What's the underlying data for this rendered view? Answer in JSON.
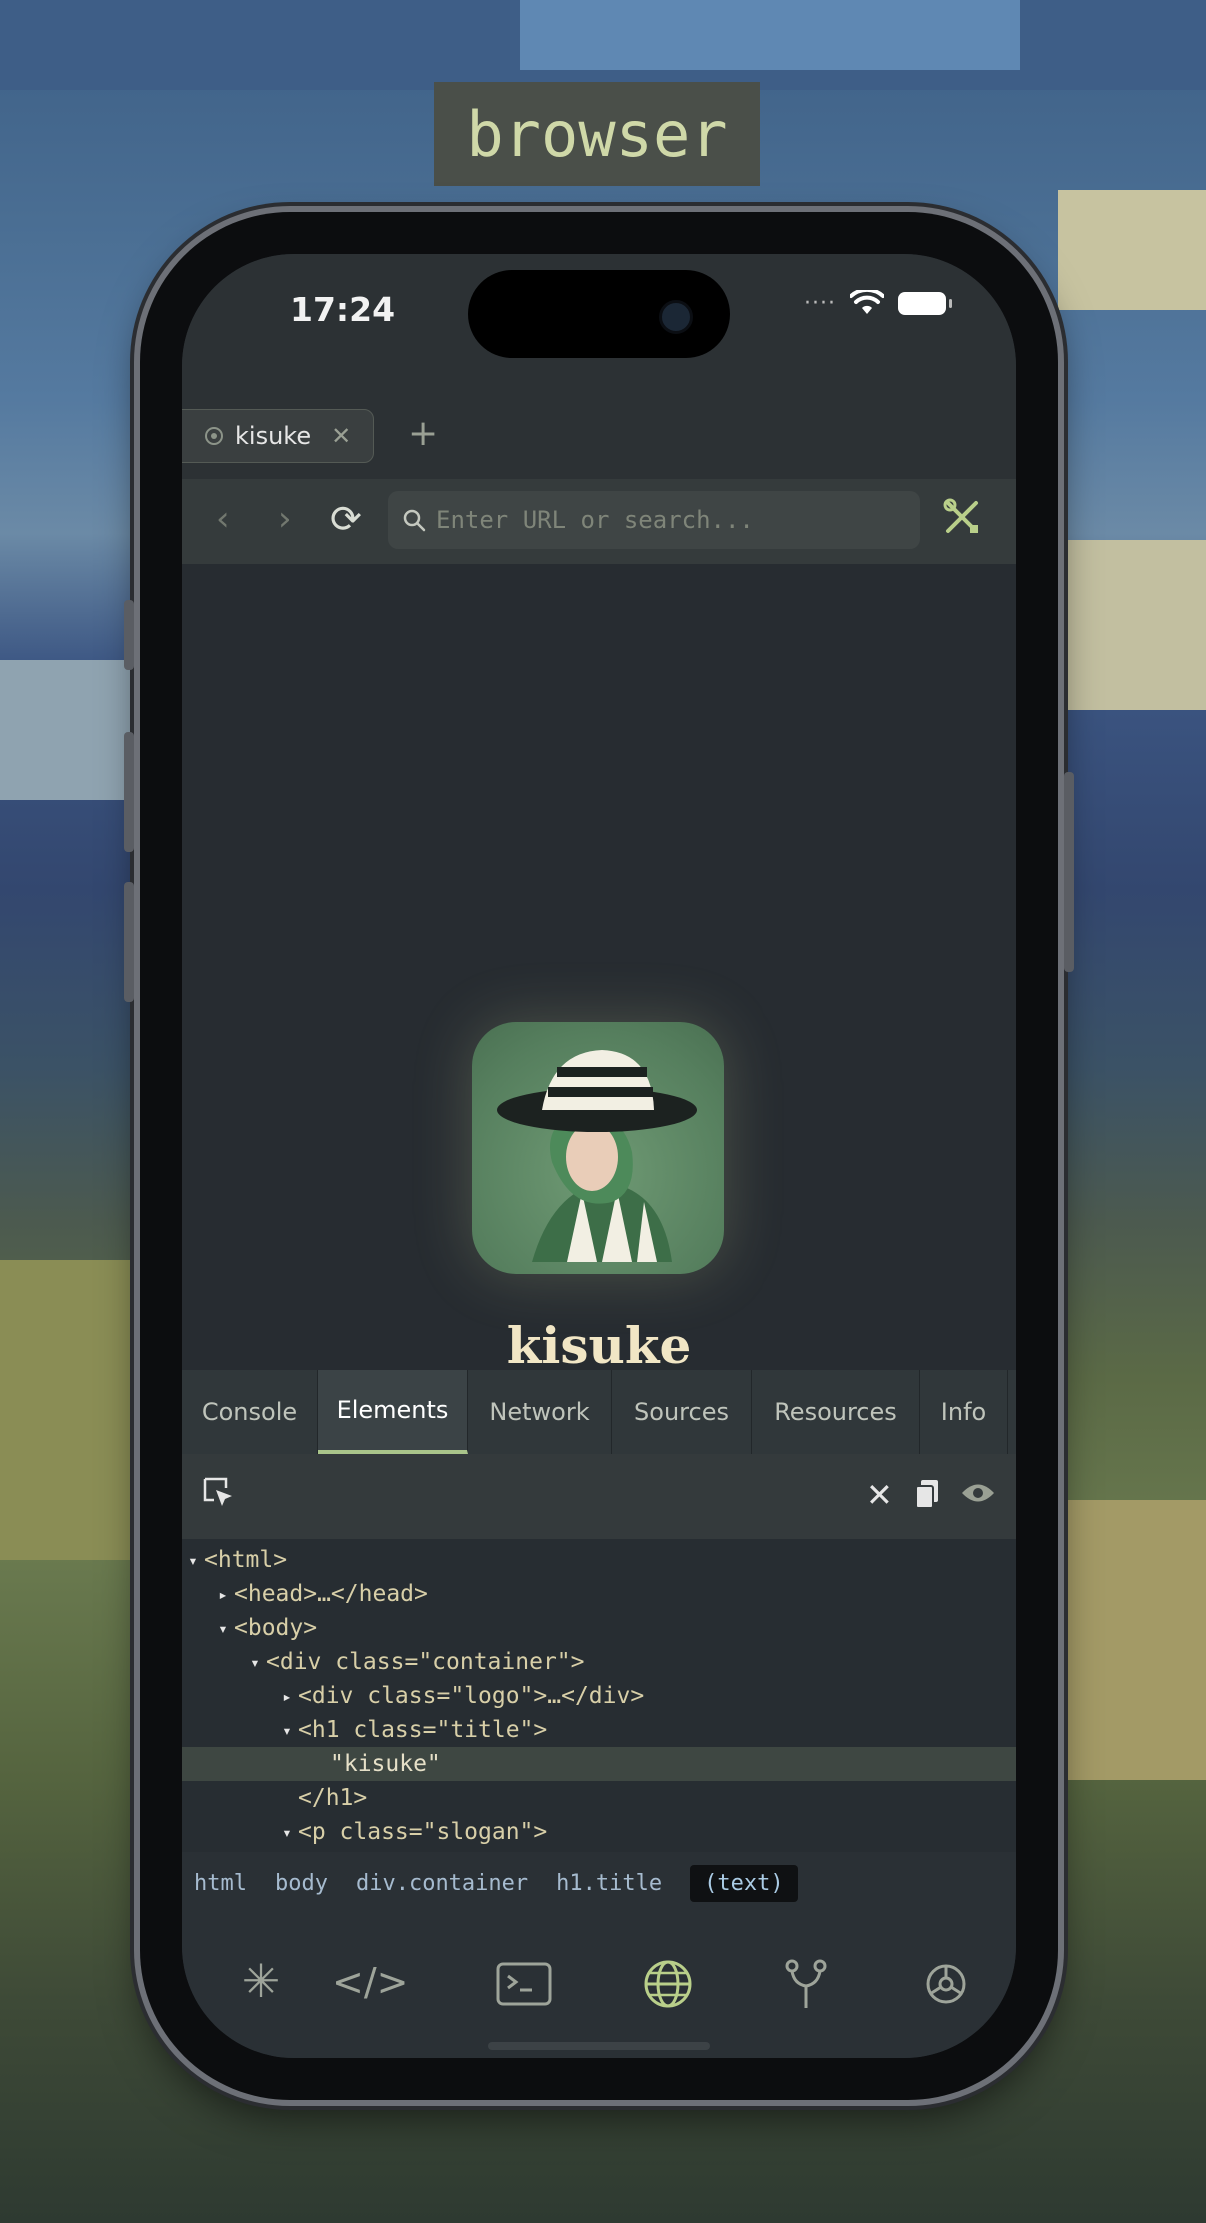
{
  "app_label": "browser",
  "status_bar": {
    "time": "17:24",
    "signal": "····",
    "wifi_icon": "wifi-icon",
    "battery_icon": "battery-icon"
  },
  "browser": {
    "tabs": [
      {
        "label": "kisuke",
        "close": "✕"
      }
    ],
    "new_tab": "+",
    "nav": {
      "back": "‹",
      "forward": "›",
      "reload": "⟳"
    },
    "url_placeholder": "Enter URL or search...",
    "tools_icon": "tools-icon"
  },
  "page": {
    "title": "kisuke"
  },
  "devtools": {
    "tabs": [
      "Console",
      "Elements",
      "Network",
      "Sources",
      "Resources",
      "Info"
    ],
    "active_tab": "Elements",
    "toolbar_icons": [
      "inspect-icon",
      "close-icon",
      "copy-icon",
      "eye-icon"
    ],
    "tree": [
      {
        "indent": 0,
        "twisty": "▾",
        "text": "<html>"
      },
      {
        "indent": 1,
        "twisty": "▸",
        "text": "<head>…</head>"
      },
      {
        "indent": 1,
        "twisty": "▾",
        "text": "<body>"
      },
      {
        "indent": 2,
        "twisty": "▾",
        "text": "<div class=\"container\">"
      },
      {
        "indent": 3,
        "twisty": "▸",
        "text": "<div class=\"logo\">…</div>"
      },
      {
        "indent": 3,
        "twisty": "▾",
        "text": "<h1 class=\"title\">"
      },
      {
        "indent": 4,
        "twisty": "",
        "text": "\"kisuke\"",
        "selected": true
      },
      {
        "indent": 3,
        "twisty": "",
        "text": "</h1>"
      },
      {
        "indent": 3,
        "twisty": "▾",
        "text": "<p class=\"slogan\">"
      }
    ],
    "breadcrumb": [
      "html",
      "body",
      "div.container",
      "h1.title",
      "(text)"
    ]
  },
  "bottom_nav": [
    {
      "name": "asterisk-icon",
      "glyph": "✳"
    },
    {
      "name": "code-icon",
      "glyph": "</>"
    },
    {
      "name": "terminal-icon",
      "glyph": "▭"
    },
    {
      "name": "globe-icon",
      "glyph": "🌐",
      "active": true
    },
    {
      "name": "git-branch-icon",
      "glyph": "Y"
    },
    {
      "name": "settings-icon",
      "glyph": "⚙"
    }
  ],
  "colors": {
    "accent": "#b9cf8a",
    "background": "#23282d",
    "title": "#f1e6c5"
  }
}
